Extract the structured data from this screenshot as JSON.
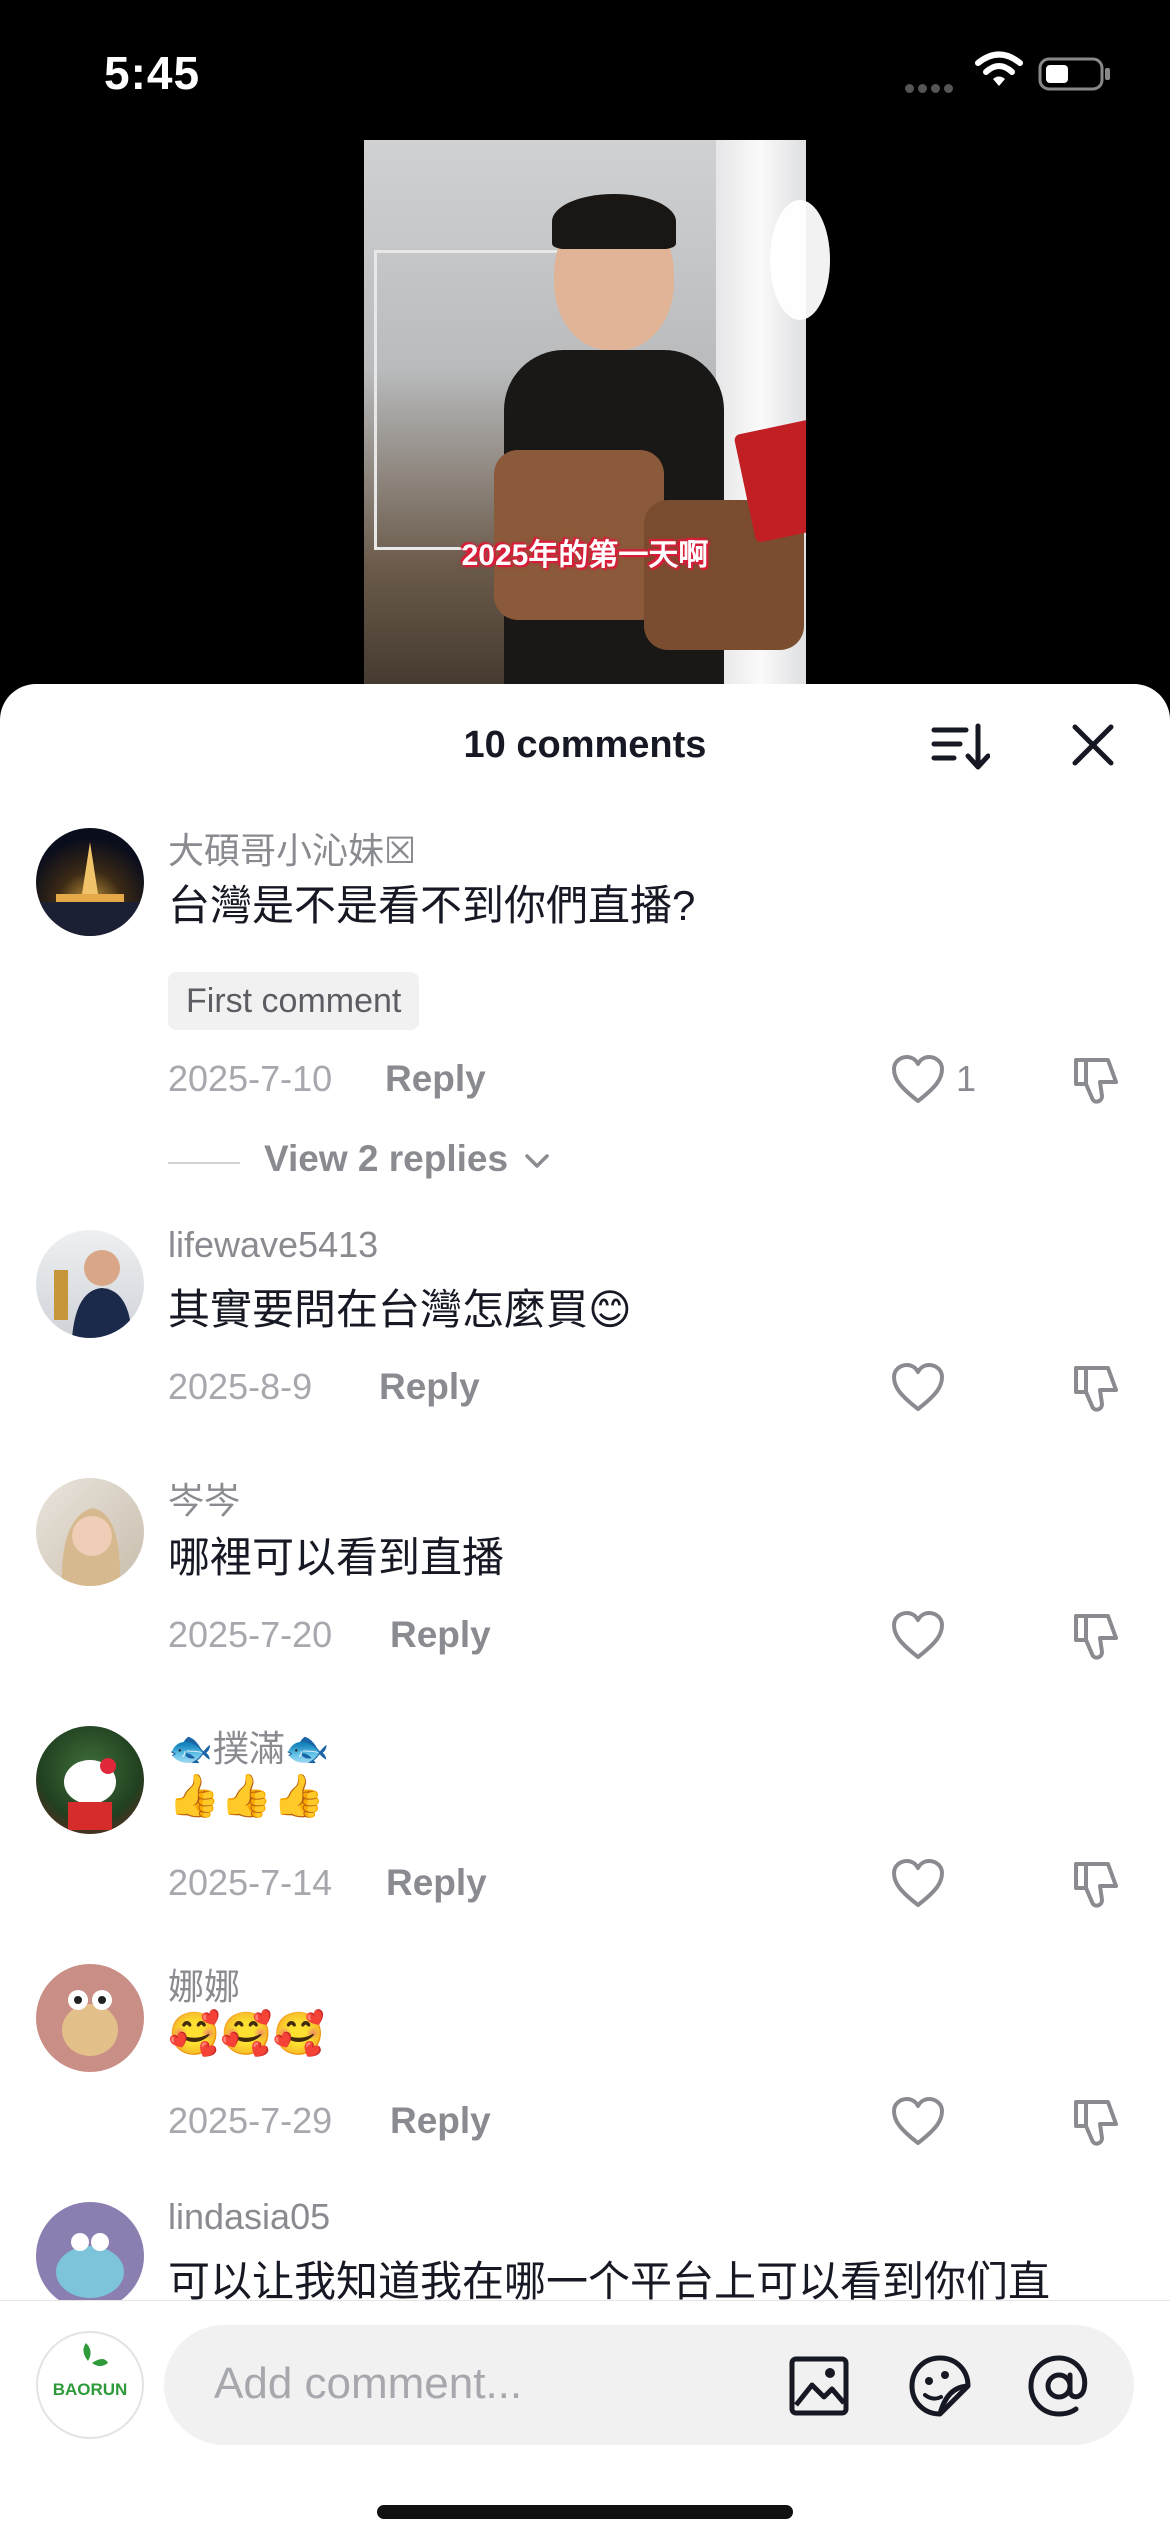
{
  "status_bar": {
    "time": "5:45"
  },
  "video": {
    "caption": "2025年的第一天啊"
  },
  "sheet": {
    "title": "10 comments"
  },
  "comments": [
    {
      "username": "大碩哥小沁妹☒",
      "text": "台灣是不是看不到你們直播?",
      "badge": "First comment",
      "date": "2025-7-10",
      "reply_label": "Reply",
      "likes": "1",
      "view_replies": "View 2 replies"
    },
    {
      "username": "lifewave5413",
      "text": "其實要問在台灣怎麼買😊",
      "date": "2025-8-9",
      "reply_label": "Reply"
    },
    {
      "username": "岑岑",
      "text": "哪裡可以看到直播",
      "date": "2025-7-20",
      "reply_label": "Reply"
    },
    {
      "username": "🐟撲滿🐟",
      "text": "👍👍👍",
      "date": "2025-7-14",
      "reply_label": "Reply"
    },
    {
      "username": "娜娜",
      "text": "🥰🥰🥰",
      "date": "2025-7-29",
      "reply_label": "Reply"
    },
    {
      "username": "lindasia05",
      "text": "可以让我知道我在哪一个平台上可以看到你们直"
    }
  ],
  "composer": {
    "placeholder": "Add comment...",
    "avatar_text": "BAORUN"
  },
  "colors": {
    "accent": "#161823",
    "muted": "#8a8b91",
    "pill": "#f1f1f2",
    "avatar_green": "#2e9a3a"
  },
  "icons": [
    "wifi-icon",
    "battery-icon",
    "sort-icon",
    "close-icon",
    "heart-icon",
    "dislike-icon",
    "chevron-down-icon",
    "image-icon",
    "sticker-icon",
    "mention-icon"
  ]
}
